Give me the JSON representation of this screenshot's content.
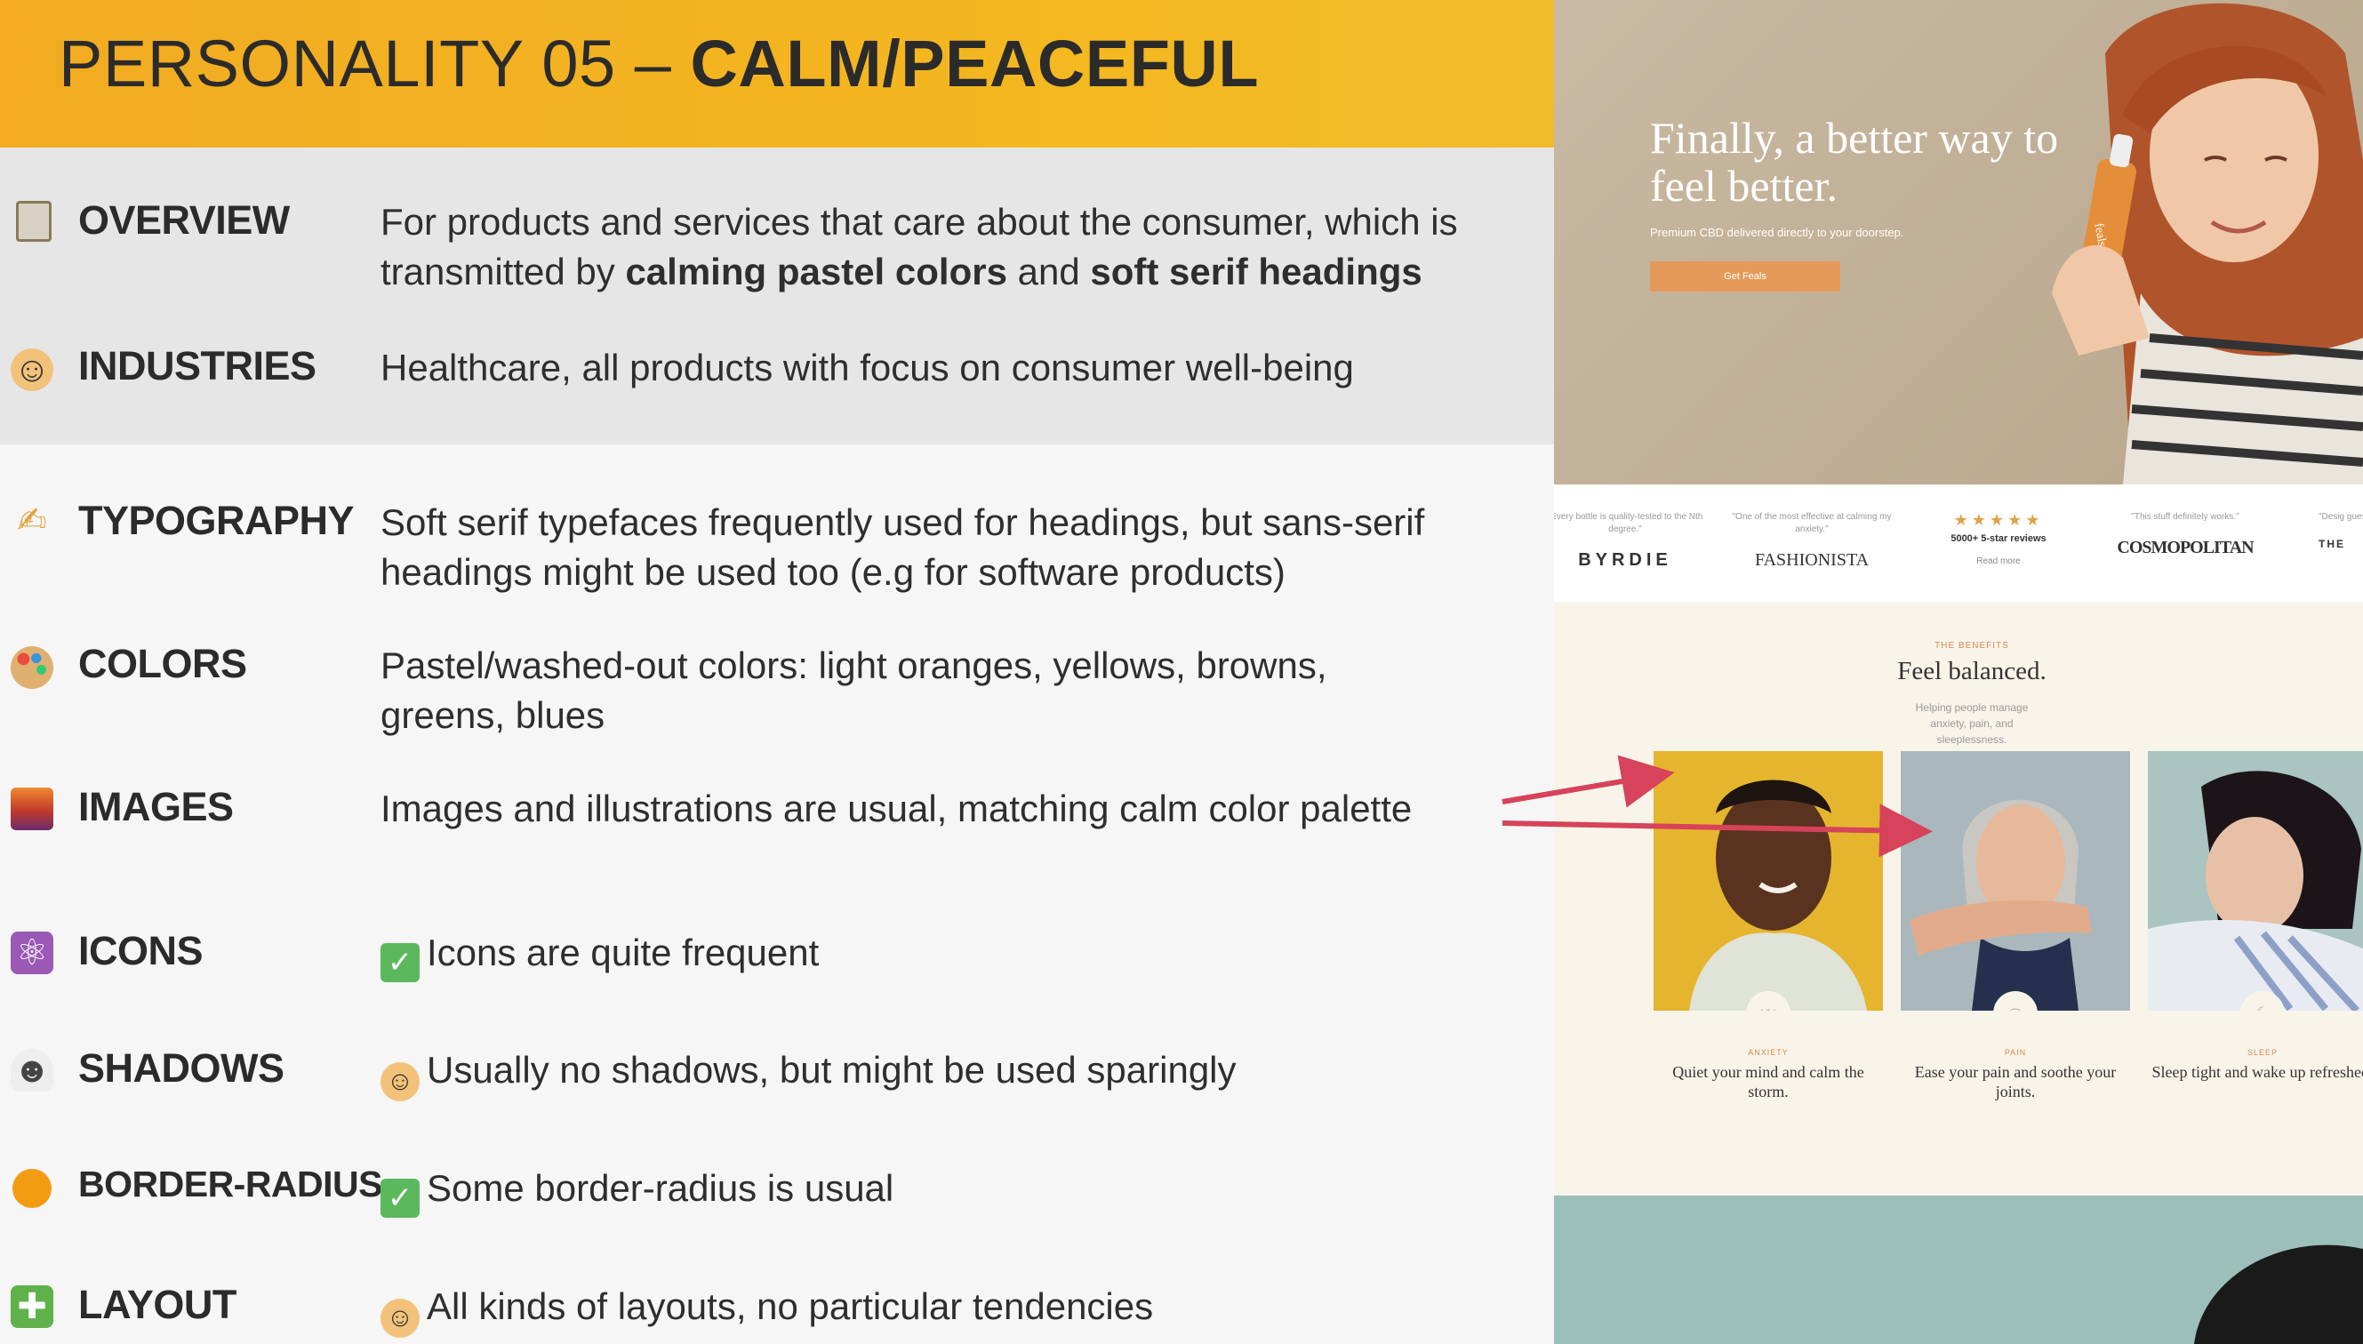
{
  "slide": {
    "title_prefix": "PERSONALITY 05 –",
    "title_bold": "CALM/PEACEFUL",
    "rows": [
      {
        "label": "OVERVIEW",
        "icon": "clipboard-icon",
        "desc_1": "For products and services that care about the consumer, which is transmitted by ",
        "desc_b1": "calming pastel colors",
        "desc_2": " and ",
        "desc_b2": "soft serif headings"
      },
      {
        "label": "INDUSTRIES",
        "icon": "worker-icon",
        "desc": "Healthcare, all products with focus on consumer well-being"
      },
      {
        "label": "TYPOGRAPHY",
        "icon": "writing-hand-icon",
        "desc": "Soft serif typefaces frequently used for headings, but sans-serif headings might be used too (e.g for software products)"
      },
      {
        "label": "COLORS",
        "icon": "palette-icon",
        "desc": "Pastel/washed-out colors: light oranges, yellows, browns, greens, blues"
      },
      {
        "label": "IMAGES",
        "icon": "sunset-image-icon",
        "desc": "Images and illustrations are usual, matching calm color palette"
      },
      {
        "label": "ICONS",
        "icon": "atom-icon",
        "desc": "Icons are quite frequent",
        "prefix_icon": "check-icon"
      },
      {
        "label": "SHADOWS",
        "icon": "ghost-icon",
        "desc": "Usually no shadows, but might be used sparingly",
        "prefix_icon": "shrug-icon"
      },
      {
        "label": "BORDER-RADIUS",
        "icon": "orange-circle-icon",
        "desc": "Some border-radius is usual",
        "prefix_icon": "check-icon"
      },
      {
        "label": "LAYOUT",
        "icon": "puzzle-icon",
        "desc": "All kinds of layouts, no particular tendencies",
        "prefix_icon": "shrug-icon"
      }
    ],
    "colors": {
      "header": "#f4b820",
      "band": "#e6e6e6",
      "arrow": "#d6435a"
    }
  },
  "site": {
    "hero": {
      "title": "Finally, a better way to feel better.",
      "subtitle": "Premium CBD delivered directly to your doorstep.",
      "button": "Get Feals",
      "bottle_label": "feals"
    },
    "press": [
      {
        "quote": "\"Every bottle is quality-tested to the Nth degree.\"",
        "logo": "BYRDIE"
      },
      {
        "quote": "\"One of the most effective at calming my anxiety.\"",
        "logo": "FASHIONISTA"
      },
      {
        "stars": "★★★★★",
        "reviews": "5000+ 5-star reviews",
        "more": "Read more"
      },
      {
        "quote": "\"This stuff definitely works.\"",
        "logo": "COSMOPOLITAN"
      },
      {
        "quote": "\"Desig guesswo",
        "logo": "THE"
      }
    ],
    "benefits": {
      "kicker": "THE BENEFITS",
      "title": "Feel balanced.",
      "subtitle": "Helping people manage anxiety, pain, and sleeplessness.",
      "cards": [
        {
          "kicker": "ANXIETY",
          "text": "Quiet your mind and calm the storm.",
          "badge_icon": "wave-icon"
        },
        {
          "kicker": "PAIN",
          "text": "Ease your pain and soothe your joints.",
          "badge_icon": "bandage-icon"
        },
        {
          "kicker": "SLEEP",
          "text": "Sleep tight and wake up refreshed.",
          "badge_icon": "moon-icon"
        }
      ]
    }
  }
}
